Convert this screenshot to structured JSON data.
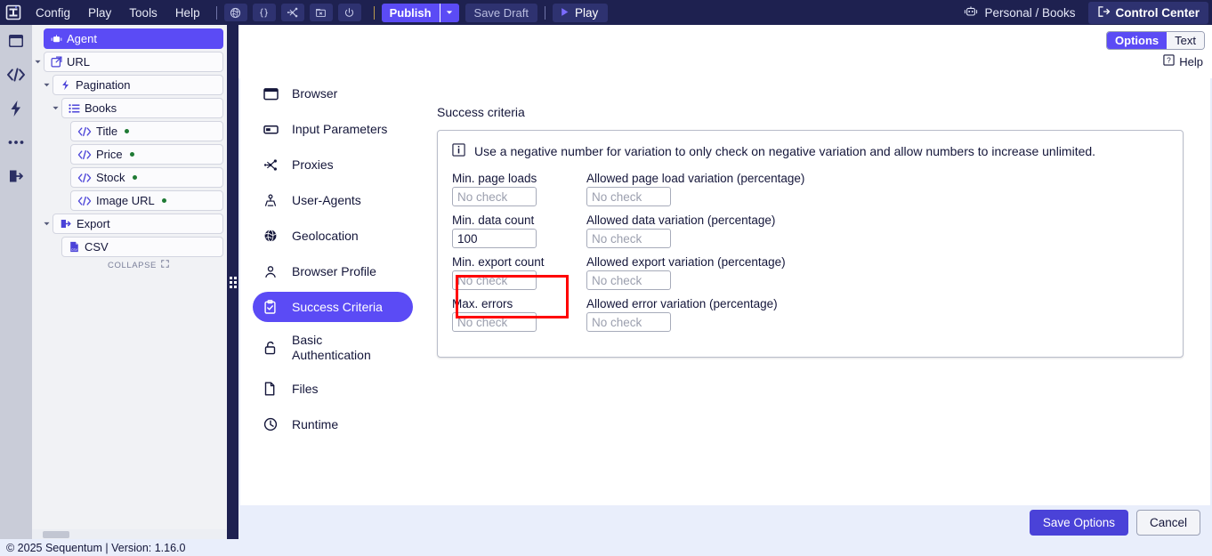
{
  "app": {
    "accent": "#5b4bf5",
    "topbar_bg": "#1e2150",
    "highlight_color": "#ff0000"
  },
  "topbar": {
    "logo_icon": "sequentum-logo-icon",
    "menus": [
      {
        "label": "Config"
      },
      {
        "label": "Play"
      },
      {
        "label": "Tools"
      },
      {
        "label": "Help"
      }
    ],
    "icon_buttons": [
      {
        "name": "globe-icon",
        "glyph": "ἱ0"
      },
      {
        "name": "braces-icon",
        "glyph": "{ }"
      },
      {
        "name": "proxy-graph-icon",
        "glyph": "proxy"
      },
      {
        "name": "folder-delete-icon",
        "glyph": "folder"
      },
      {
        "name": "power-icon",
        "glyph": "power"
      }
    ],
    "publish_label": "Publish",
    "publish_caret_icon": "chevron-down-icon",
    "save_draft_label": "Save Draft",
    "play_label": "Play",
    "play_icon": "play-triangle-icon",
    "workspace_icon": "robot-icon",
    "workspace_label": "Personal / Books",
    "control_center_label": "Control Center",
    "control_center_icon": "exit-arrow-icon"
  },
  "rail": {
    "icons": [
      {
        "name": "browser-window-icon"
      },
      {
        "name": "code-brackets-icon"
      },
      {
        "name": "lightning-bolt-icon"
      },
      {
        "name": "ellipsis-icon"
      },
      {
        "name": "export-icon"
      }
    ]
  },
  "sidebar": {
    "tree": [
      {
        "label": "Agent",
        "icon": "robot-icon",
        "indent": 0,
        "twisty": "",
        "selected": true,
        "dot": false
      },
      {
        "label": "URL",
        "icon": "external-link-icon",
        "indent": 0,
        "twisty": "down",
        "selected": false,
        "dot": false
      },
      {
        "label": "Pagination",
        "icon": "pagination-icon",
        "indent": 1,
        "twisty": "down",
        "selected": false,
        "dot": false
      },
      {
        "label": "Books",
        "icon": "list-icon",
        "indent": 2,
        "twisty": "down",
        "selected": false,
        "dot": false
      },
      {
        "label": "Title",
        "icon": "code-brackets-icon",
        "indent": 3,
        "twisty": "",
        "selected": false,
        "dot": true
      },
      {
        "label": "Price",
        "icon": "code-brackets-icon",
        "indent": 3,
        "twisty": "",
        "selected": false,
        "dot": true
      },
      {
        "label": "Stock",
        "icon": "code-brackets-icon",
        "indent": 3,
        "twisty": "",
        "selected": false,
        "dot": true
      },
      {
        "label": "Image URL",
        "icon": "code-brackets-icon",
        "indent": 3,
        "twisty": "",
        "selected": false,
        "dot": true
      },
      {
        "label": "Export",
        "icon": "export-icon",
        "indent": 1,
        "twisty": "down",
        "selected": false,
        "dot": false
      },
      {
        "label": "CSV",
        "icon": "csv-file-icon",
        "indent": 2,
        "twisty": "",
        "selected": false,
        "dot": false
      }
    ],
    "collapse_label": "COLLAPSE",
    "collapse_icon": "expand-collapse-icon"
  },
  "pane": {
    "view_toggle": {
      "options": [
        "Options",
        "Text"
      ],
      "selected": "Options"
    },
    "help_label": "Help",
    "help_icon": "question-box-icon",
    "nav_items": [
      {
        "label": "Browser",
        "icon": "browser-window-icon",
        "active": false
      },
      {
        "label": "Input Parameters",
        "icon": "input-field-icon",
        "active": false
      },
      {
        "label": "Proxies",
        "icon": "proxy-graph-icon",
        "active": false
      },
      {
        "label": "User-Agents",
        "icon": "user-agent-icon",
        "active": false
      },
      {
        "label": "Geolocation",
        "icon": "globe-icon",
        "active": false
      },
      {
        "label": "Browser Profile",
        "icon": "person-icon",
        "active": false
      },
      {
        "label": "Success Criteria",
        "icon": "clipboard-check-icon",
        "active": true
      },
      {
        "label": "Basic Authentication",
        "icon": "lock-open-icon",
        "active": false
      },
      {
        "label": "Files",
        "icon": "file-icon",
        "active": false
      },
      {
        "label": "Runtime",
        "icon": "clock-icon",
        "active": false
      }
    ],
    "section_title": "Success criteria",
    "info_icon": "info-icon",
    "info_text": "Use a negative number for variation to only check on negative variation and allow numbers to increase unlimited.",
    "fields": [
      {
        "label": "Min. page loads",
        "value": "",
        "placeholder": "No check",
        "name": "min-page-loads"
      },
      {
        "label": "Allowed page load variation (percentage)",
        "value": "",
        "placeholder": "No check",
        "name": "allowed-page-load-variation"
      },
      {
        "label": "Min. data count",
        "value": "100",
        "placeholder": "No check",
        "name": "min-data-count"
      },
      {
        "label": "Allowed data variation (percentage)",
        "value": "",
        "placeholder": "No check",
        "name": "allowed-data-variation"
      },
      {
        "label": "Min. export count",
        "value": "",
        "placeholder": "No check",
        "name": "min-export-count"
      },
      {
        "label": "Allowed export variation (percentage)",
        "value": "",
        "placeholder": "No check",
        "name": "allowed-export-variation"
      },
      {
        "label": "Max. errors",
        "value": "",
        "placeholder": "No check",
        "name": "max-errors"
      },
      {
        "label": "Allowed error variation (percentage)",
        "value": "",
        "placeholder": "No check",
        "name": "allowed-error-variation"
      }
    ],
    "save_label": "Save Options",
    "cancel_label": "Cancel"
  },
  "statusbar": {
    "text": "© 2025 Sequentum | Version: 1.16.0"
  }
}
